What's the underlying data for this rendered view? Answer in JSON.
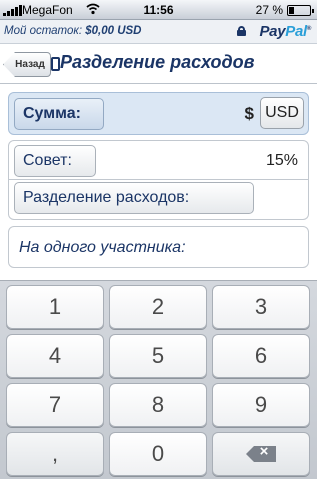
{
  "status_bar": {
    "carrier": "MegaFon",
    "time": "11:56",
    "battery": "27 %",
    "battery_level": 0.27
  },
  "info_bar": {
    "balance_label": "Мой остаток:",
    "balance_value": "$0,00 USD",
    "brand_pay": "Pay",
    "brand_pal": "Pal"
  },
  "nav": {
    "back_label": "Назад",
    "title": "Разделение расходов"
  },
  "form": {
    "amount_label": "Сумма:",
    "currency_symbol": "$",
    "currency_code": "USD",
    "tip_label": "Совет:",
    "tip_value": "15%",
    "split_label": "Разделение расходов:",
    "per_person_label": "На одного участника:"
  },
  "keypad": {
    "keys": [
      "1",
      "2",
      "3",
      "4",
      "5",
      "6",
      "7",
      "8",
      "9",
      ",",
      "0"
    ],
    "backspace_icon": "backspace-icon"
  },
  "colors": {
    "brand_dark": "#1b3566",
    "brand_light": "#2a9fd8",
    "amount_highlight": "#dbe7f4"
  }
}
